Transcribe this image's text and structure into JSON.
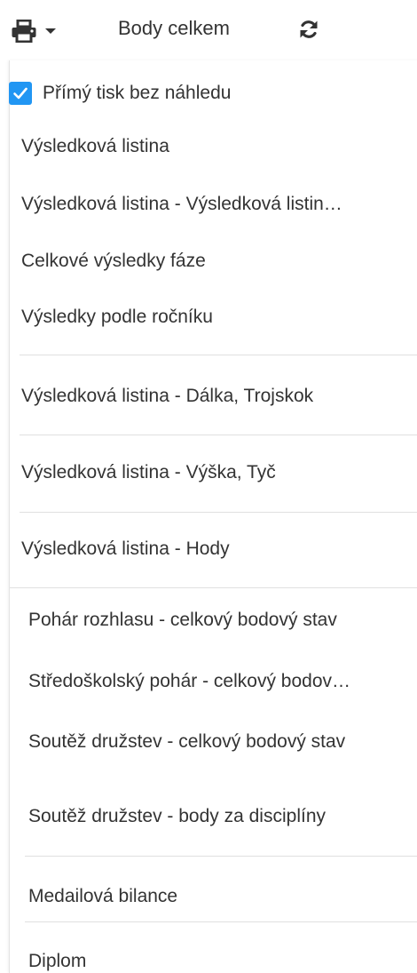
{
  "toolbar": {
    "print_icon": "printer-icon",
    "dropdown_icon": "caret-down-icon",
    "label": "Body celkem",
    "refresh_icon": "refresh-icon"
  },
  "menu": {
    "direct_print": {
      "label": "Přímý tisk bez náhledu",
      "checked": true
    },
    "items": [
      "Výsledková listina",
      "Výsledková listina - Výsledková listin…",
      "Celkové výsledky fáze",
      "Výsledky podle ročníku",
      "Výsledková listina - Dálka, Trojskok",
      "Výsledková listina - Výška, Tyč",
      "Výsledková listina - Hody",
      "Pohár rozhlasu - celkový bodový stav",
      "Středoškolský pohár - celkový bodov…",
      "Soutěž družstev - celkový bodový stav",
      "Soutěž družstev - body za disciplíny",
      "Medailová bilance",
      "Diplom"
    ]
  },
  "colors": {
    "accent": "#2196f3",
    "text": "#333333",
    "separator": "#e0e0e0"
  }
}
